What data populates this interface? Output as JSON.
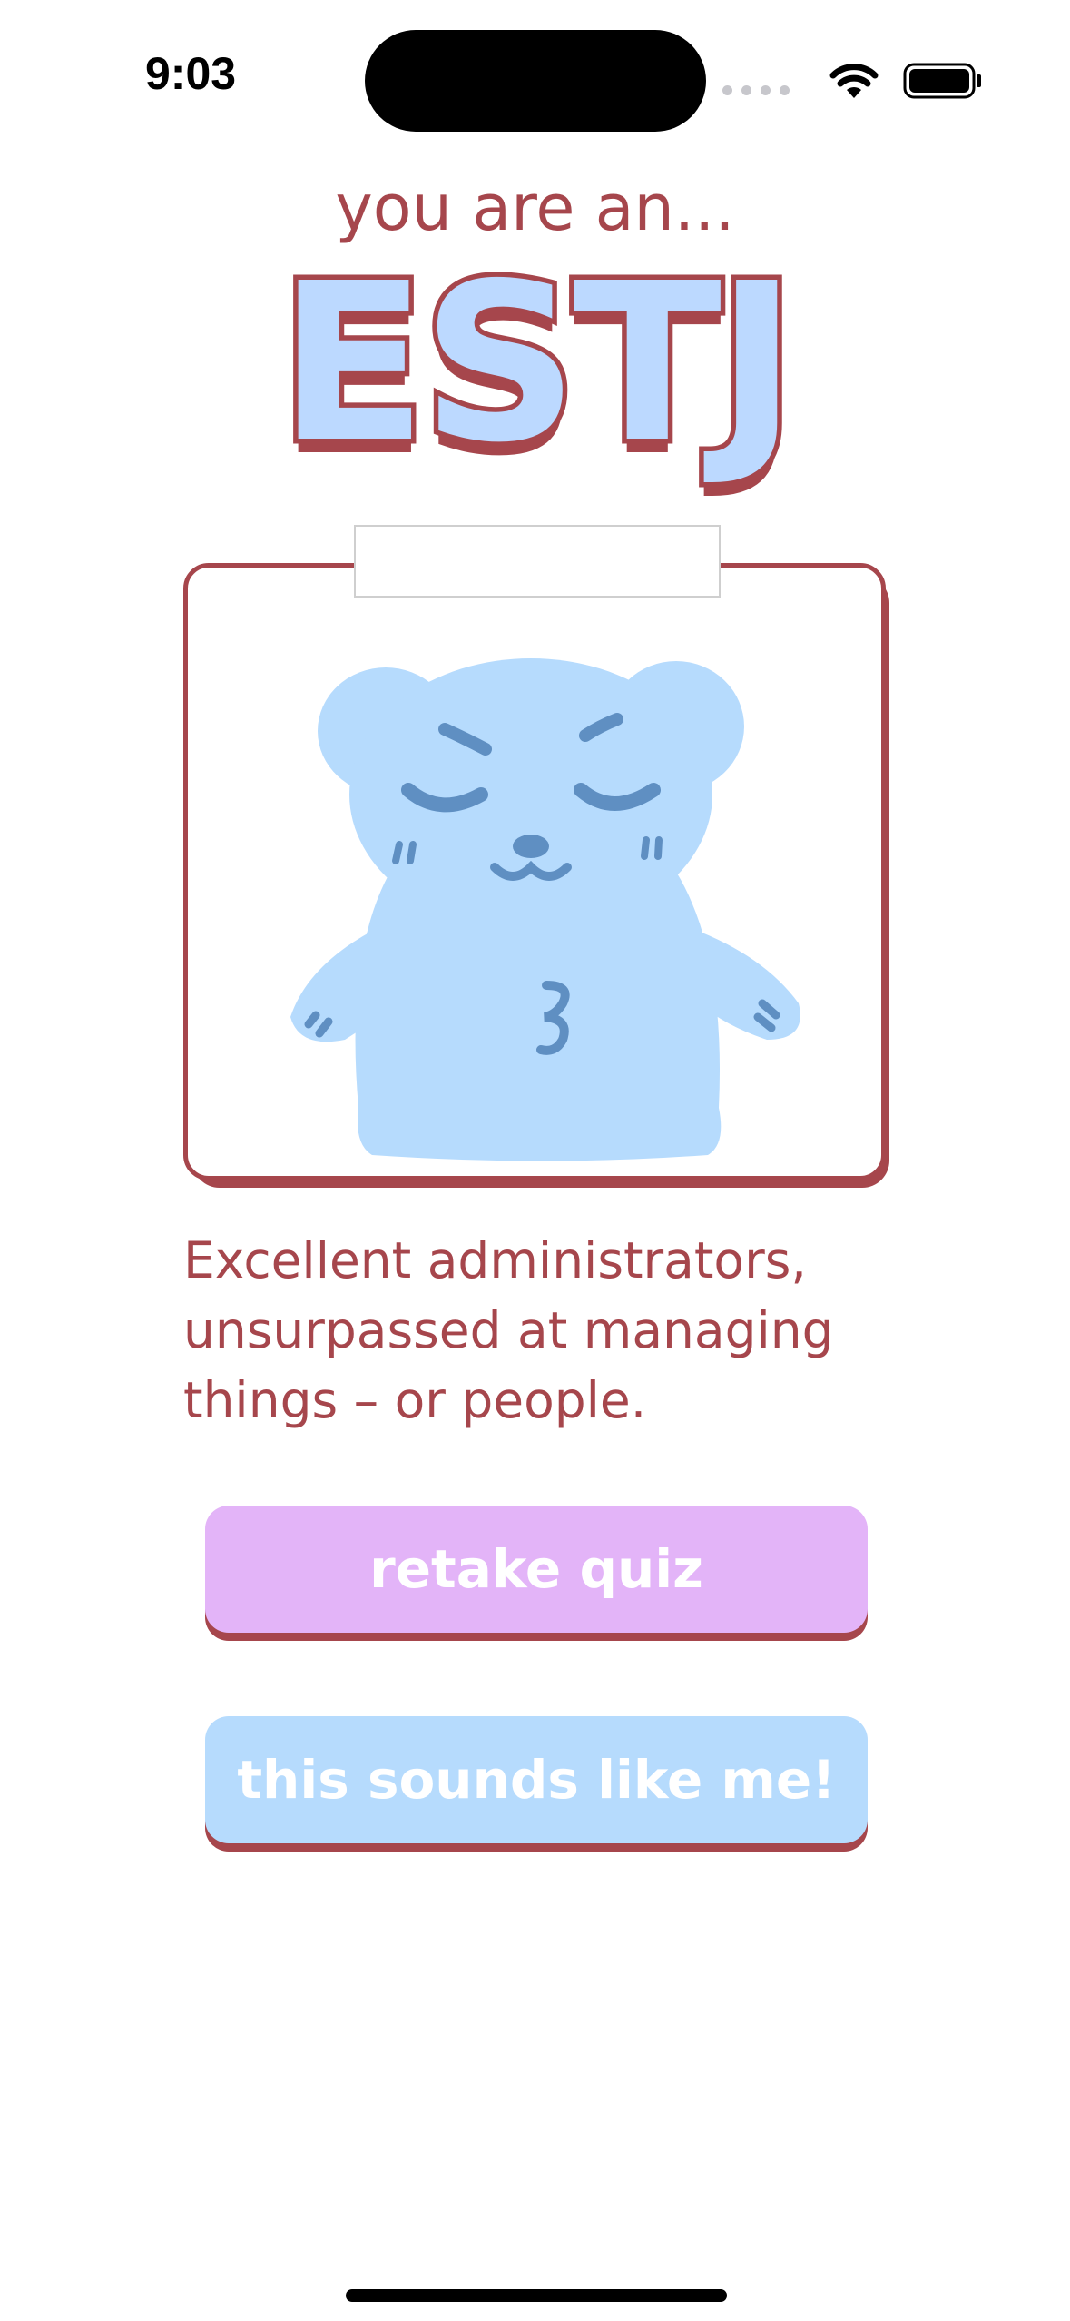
{
  "status_bar": {
    "time": "9:03",
    "icons": [
      "cellular-dots-icon",
      "wifi-icon",
      "battery-icon"
    ]
  },
  "result": {
    "eyebrow": "you are an...",
    "type": "ESTJ",
    "description": "Excellent administrators, unsurpassed at managing things – or people.",
    "image": "bear-illustration"
  },
  "buttons": {
    "retake_label": "retake quiz",
    "confirm_label": "this sounds like me!"
  },
  "colors": {
    "accent": "#a6464c",
    "title_fill": "#bcd9ff",
    "retake_button": "#e3b4f8",
    "confirm_button": "#b6dbfd",
    "bear_body": "#b6dbfd",
    "bear_features": "#5f8fc2"
  }
}
